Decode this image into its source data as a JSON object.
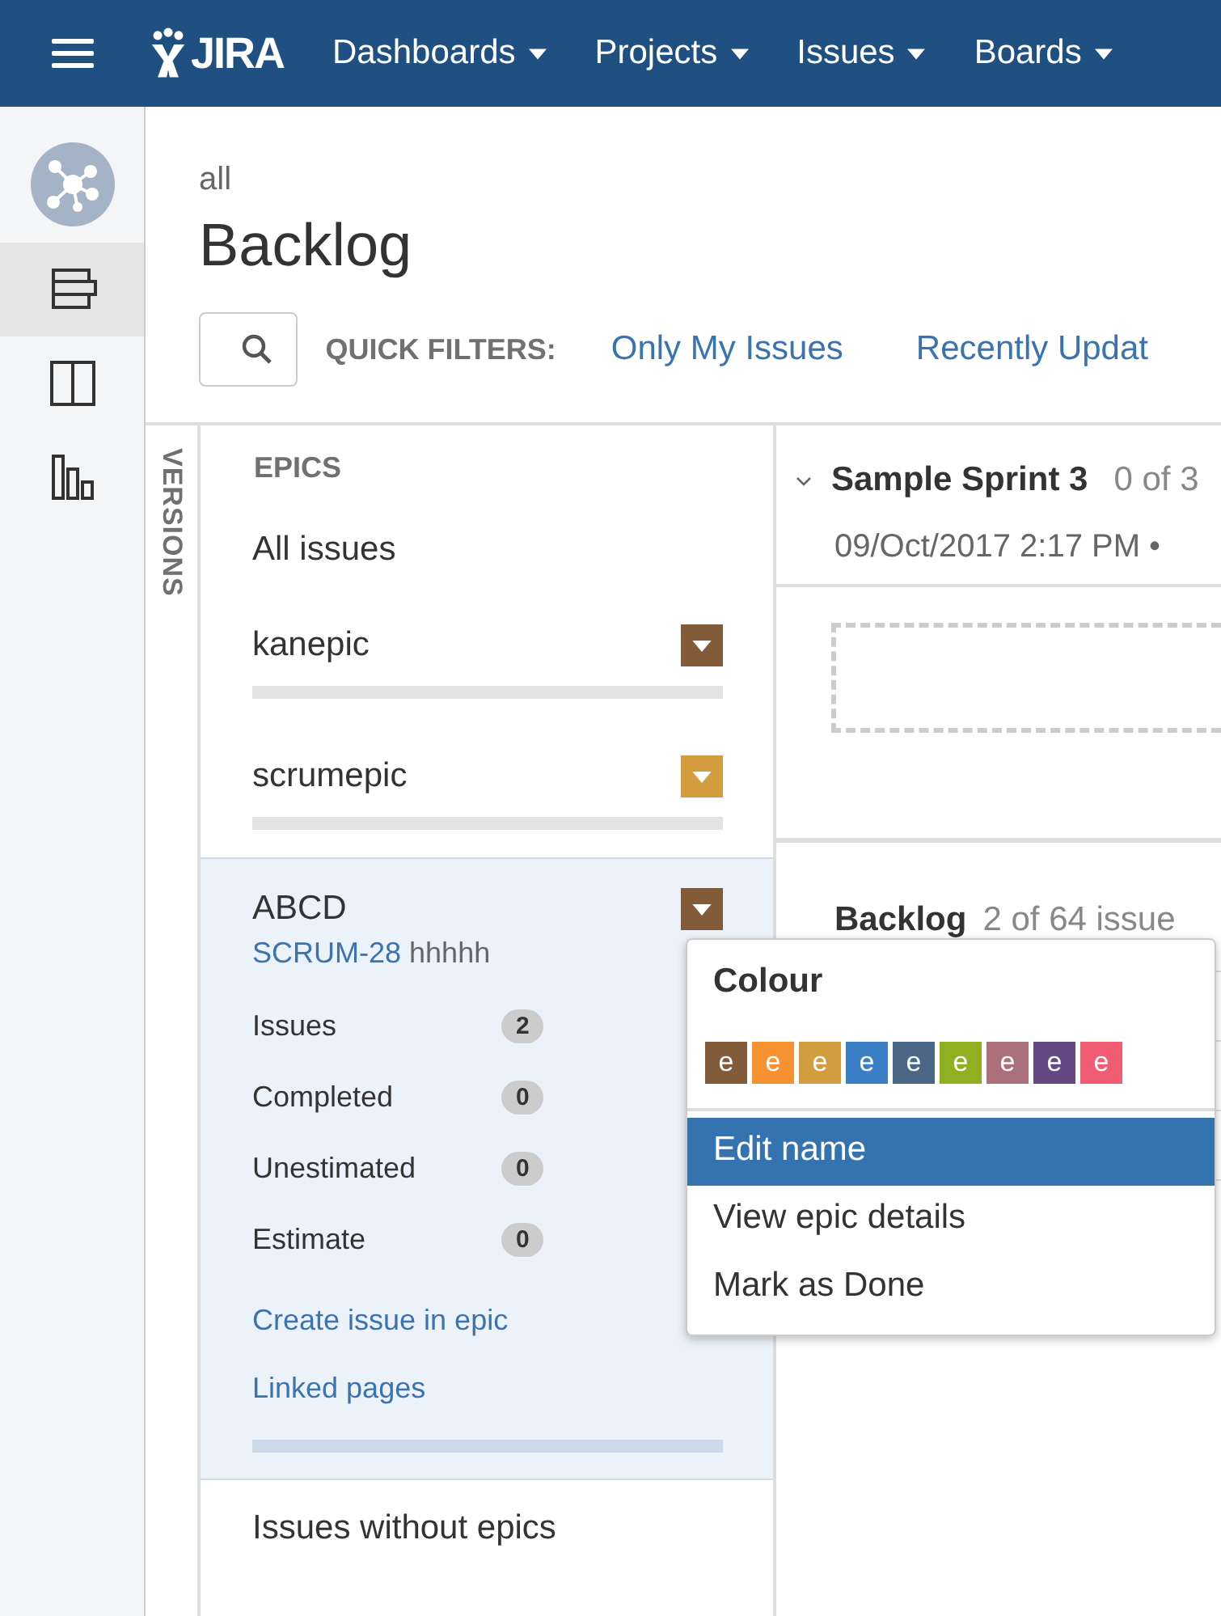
{
  "topbar": {
    "logo": "JIRA",
    "nav": [
      {
        "label": "Dashboards"
      },
      {
        "label": "Projects"
      },
      {
        "label": "Issues"
      },
      {
        "label": "Boards"
      }
    ]
  },
  "sidebar": {
    "items": [
      {
        "kind": "project",
        "selected": false
      },
      {
        "kind": "backlog",
        "selected": true
      },
      {
        "kind": "board",
        "selected": false
      },
      {
        "kind": "reports",
        "selected": false
      }
    ]
  },
  "header": {
    "breadcrumb": "all",
    "title": "Backlog"
  },
  "quick_filters": {
    "label": "QUICK FILTERS:",
    "filters": [
      "Only My Issues",
      "Recently Updat"
    ]
  },
  "versions_tab": "VERSIONS",
  "epics": {
    "heading": "EPICS",
    "all_issues": "All issues",
    "items": [
      {
        "name": "kanepic",
        "color": "#815b3a",
        "selected": false,
        "level": 0
      },
      {
        "name": "scrumepic",
        "color": "#d39c3f",
        "selected": false,
        "level": 0
      },
      {
        "name": "ABCD",
        "color": "#815b3a",
        "selected": true,
        "level": 0,
        "key": "SCRUM-28",
        "summary": "hhhhh",
        "stats": [
          {
            "label": "Issues",
            "count": "2"
          },
          {
            "label": "Completed",
            "count": "0"
          },
          {
            "label": "Unestimated",
            "count": "0"
          },
          {
            "label": "Estimate",
            "count": "0"
          }
        ],
        "links": [
          "Create issue in epic",
          "Linked pages"
        ]
      }
    ],
    "without": "Issues without epics"
  },
  "sprint": {
    "name": "Sample Sprint 3",
    "count": "0 of 3",
    "dates": "09/Oct/2017 2:17 PM •"
  },
  "backlog": {
    "title": "Backlog",
    "count": "2 of 64 issue"
  },
  "menu": {
    "heading": "Colour",
    "swatches": [
      {
        "letter": "e",
        "color": "#815b3a"
      },
      {
        "letter": "e",
        "color": "#f79232"
      },
      {
        "letter": "e",
        "color": "#d39c3f"
      },
      {
        "letter": "e",
        "color": "#3b7fc4"
      },
      {
        "letter": "e",
        "color": "#4a6785"
      },
      {
        "letter": "e",
        "color": "#8eb021"
      },
      {
        "letter": "e",
        "color": "#ac707a"
      },
      {
        "letter": "e",
        "color": "#654982"
      },
      {
        "letter": "e",
        "color": "#f15c75"
      }
    ],
    "items": [
      {
        "label": "Edit name",
        "selected": true
      },
      {
        "label": "View epic details",
        "selected": false
      },
      {
        "label": "Mark as Done",
        "selected": false
      }
    ]
  }
}
